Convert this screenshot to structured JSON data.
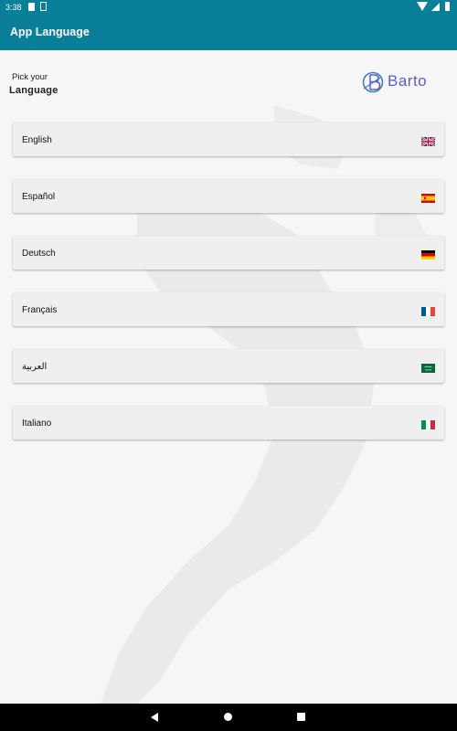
{
  "status_bar": {
    "time": "3:38",
    "icons": [
      "sd-card-icon",
      "sim-icon",
      "wifi-icon",
      "signal-icon",
      "battery-icon"
    ]
  },
  "app_bar": {
    "title": "App Language"
  },
  "header": {
    "pick_label": "Pick your",
    "language_label": "Language",
    "logo_text": "Barto"
  },
  "languages": [
    {
      "label": "English",
      "flag": "uk-flag-icon"
    },
    {
      "label": "Español",
      "flag": "spain-flag-icon"
    },
    {
      "label": "Deutsch",
      "flag": "germany-flag-icon"
    },
    {
      "label": "Français",
      "flag": "france-flag-icon"
    },
    {
      "label": "العربية",
      "flag": "saudi-flag-icon"
    },
    {
      "label": "Italiano",
      "flag": "italy-flag-icon"
    }
  ],
  "nav_bar": {
    "icons": [
      "back-icon",
      "home-icon",
      "recents-icon"
    ]
  },
  "colors": {
    "primary": "#0a7f99",
    "logo": "#5a5fc4",
    "row_bg": "#efefef",
    "page_bg": "#f6f6f6"
  }
}
